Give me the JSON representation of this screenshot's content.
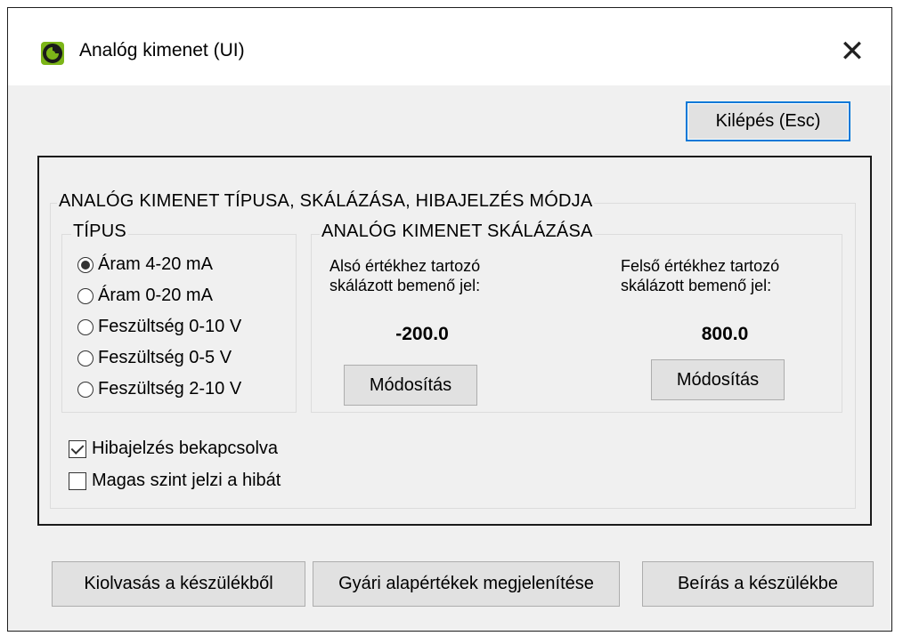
{
  "window": {
    "title": "Analóg kimenet (UI)",
    "app_icon": "app-logo-icon",
    "close_glyph": "✕"
  },
  "toolbar": {
    "exit_label": "Kilépés (Esc)"
  },
  "main": {
    "group_title": "ANALÓG KIMENET TÍPUSA, SKÁLÁZÁSA, HIBAJELZÉS MÓDJA",
    "type_group": {
      "title": "TÍPUS",
      "options": [
        {
          "label": "Áram 4-20 mA",
          "selected": true
        },
        {
          "label": "Áram 0-20 mA",
          "selected": false
        },
        {
          "label": "Feszültség 0-10 V",
          "selected": false
        },
        {
          "label": "Feszültség 0-5 V",
          "selected": false
        },
        {
          "label": "Feszültség 2-10 V",
          "selected": false
        }
      ]
    },
    "scaling_group": {
      "title": "ANALÓG KIMENET SKÁLÁZÁSA",
      "lower": {
        "label_line1": "Alsó értékhez tartozó",
        "label_line2": "skálázott bemenő jel:",
        "value": "-200.0",
        "modify_label": "Módosítás"
      },
      "upper": {
        "label_line1": "Felső értékhez tartozó",
        "label_line2": "skálázott bemenő jel:",
        "value": "800.0",
        "modify_label": "Módosítás"
      }
    },
    "checkboxes": [
      {
        "label": "Hibajelzés bekapcsolva",
        "checked": true
      },
      {
        "label": "Magas szint jelzi a hibát",
        "checked": false
      }
    ]
  },
  "footer": {
    "read_label": "Kiolvasás a készülékből",
    "defaults_label": "Gyári alapértékek megjelenítése",
    "write_label": "Beírás a készülékbe"
  },
  "colors": {
    "accent": "#0078d7",
    "window_bg": "#f0f0f0",
    "icon_green": "#7cb518"
  }
}
